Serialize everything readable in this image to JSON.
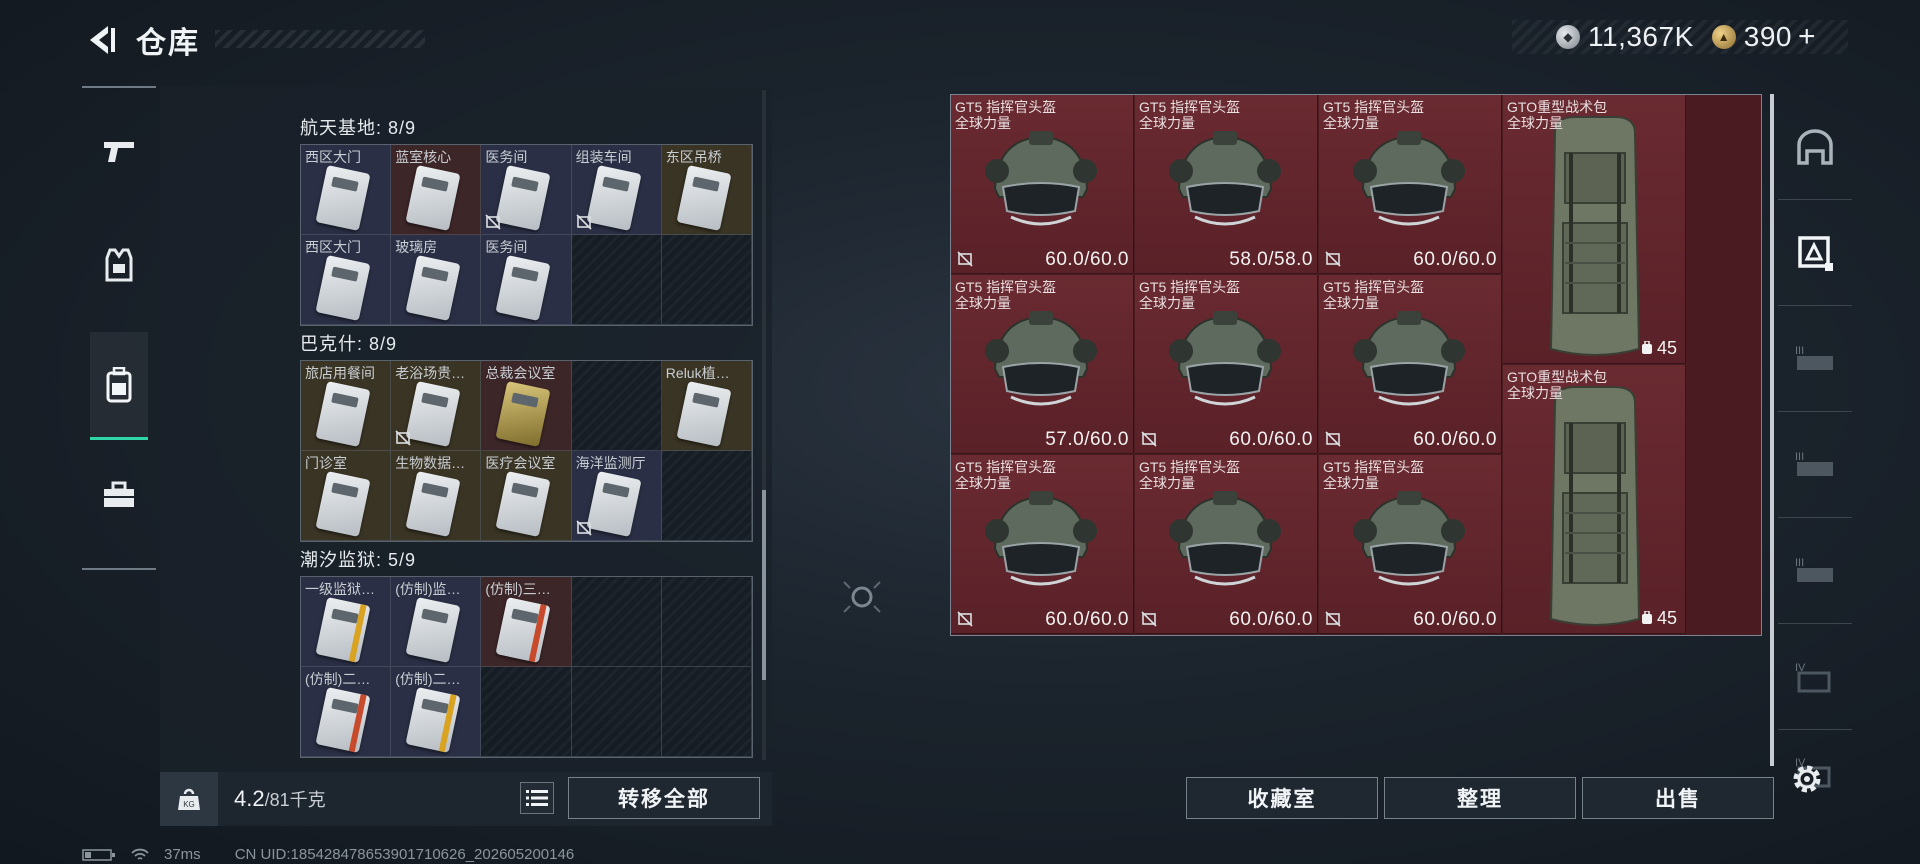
{
  "header": {
    "title": "仓库"
  },
  "currency": {
    "silver": "11,367K",
    "gold": "390",
    "plus": "+"
  },
  "left_rail": {
    "items": [
      "weapon",
      "armor",
      "backpack",
      "toolbox"
    ],
    "active_index": 2
  },
  "storage": {
    "sections": [
      {
        "title": "航天基地: 8/9",
        "cells": [
          {
            "name": "西区大门",
            "bg": "blue",
            "locked": false
          },
          {
            "name": "蓝室核心",
            "bg": "red",
            "locked": false
          },
          {
            "name": "医务间",
            "bg": "blue",
            "locked": true
          },
          {
            "name": "组装车间",
            "bg": "blue",
            "locked": true
          },
          {
            "name": "东区吊桥",
            "bg": "yellow",
            "locked": false
          },
          {
            "name": "西区大门",
            "bg": "blue",
            "locked": false
          },
          {
            "name": "玻璃房",
            "bg": "blue",
            "locked": false
          },
          {
            "name": "医务间",
            "bg": "blue",
            "locked": false
          },
          {
            "name": "",
            "bg": "empty",
            "locked": false
          },
          {
            "name": "",
            "bg": "empty",
            "locked": false
          }
        ]
      },
      {
        "title": "巴克什: 8/9",
        "cells": [
          {
            "name": "旅店用餐间",
            "bg": "yellow",
            "locked": false
          },
          {
            "name": "老浴场贵…",
            "bg": "yellow",
            "locked": true
          },
          {
            "name": "总裁会议室",
            "bg": "red",
            "locked": false,
            "gold": true
          },
          {
            "name": "",
            "bg": "empty",
            "locked": false
          },
          {
            "name": "Reluk植…",
            "bg": "yellow",
            "locked": false
          },
          {
            "name": "门诊室",
            "bg": "yellow",
            "locked": false
          },
          {
            "name": "生物数据…",
            "bg": "yellow",
            "locked": false
          },
          {
            "name": "医疗会议室",
            "bg": "yellow",
            "locked": false
          },
          {
            "name": "海洋监测厅",
            "bg": "blue",
            "locked": true
          },
          {
            "name": "",
            "bg": "empty",
            "locked": false
          }
        ]
      },
      {
        "title": "潮汐监狱: 5/9",
        "cells": [
          {
            "name": "一级监狱…",
            "bg": "blue",
            "locked": false,
            "stripe": "y"
          },
          {
            "name": "(仿制)监…",
            "bg": "blue",
            "locked": false
          },
          {
            "name": "(仿制)三…",
            "bg": "red",
            "locked": false,
            "stripe": "r"
          },
          {
            "name": "",
            "bg": "empty",
            "locked": false
          },
          {
            "name": "",
            "bg": "empty",
            "locked": false
          },
          {
            "name": "(仿制)二…",
            "bg": "blue",
            "locked": false,
            "stripe": "r"
          },
          {
            "name": "(仿制)二…",
            "bg": "blue",
            "locked": false,
            "stripe": "y"
          },
          {
            "name": "",
            "bg": "empty",
            "locked": false
          },
          {
            "name": "",
            "bg": "empty",
            "locked": false
          },
          {
            "name": "",
            "bg": "empty",
            "locked": false
          }
        ]
      }
    ]
  },
  "weight": {
    "current": "4.2",
    "max": "/81千克"
  },
  "buttons": {
    "transfer_all": "转移全部",
    "collection": "收藏室",
    "sort": "整理",
    "sell": "出售"
  },
  "items": [
    {
      "name1": "GT5 指挥官头盔",
      "name2": "全球力量",
      "value": "60.0/60.0",
      "type": "helmet",
      "locked": true,
      "col": 0,
      "row": 0
    },
    {
      "name1": "GT5 指挥官头盔",
      "name2": "全球力量",
      "value": "58.0/58.0",
      "type": "helmet",
      "locked": false,
      "col": 1,
      "row": 0
    },
    {
      "name1": "GT5 指挥官头盔",
      "name2": "全球力量",
      "value": "60.0/60.0",
      "type": "helmet",
      "locked": true,
      "col": 2,
      "row": 0
    },
    {
      "name1": "GT5 指挥官头盔",
      "name2": "全球力量",
      "value": "57.0/60.0",
      "type": "helmet",
      "locked": false,
      "col": 0,
      "row": 1
    },
    {
      "name1": "GT5 指挥官头盔",
      "name2": "全球力量",
      "value": "60.0/60.0",
      "type": "helmet",
      "locked": true,
      "col": 1,
      "row": 1
    },
    {
      "name1": "GT5 指挥官头盔",
      "name2": "全球力量",
      "value": "60.0/60.0",
      "type": "helmet",
      "locked": true,
      "col": 2,
      "row": 1
    },
    {
      "name1": "GT5 指挥官头盔",
      "name2": "全球力量",
      "value": "60.0/60.0",
      "type": "helmet",
      "locked": true,
      "col": 0,
      "row": 2
    },
    {
      "name1": "GT5 指挥官头盔",
      "name2": "全球力量",
      "value": "60.0/60.0",
      "type": "helmet",
      "locked": true,
      "col": 1,
      "row": 2
    },
    {
      "name1": "GT5 指挥官头盔",
      "name2": "全球力量",
      "value": "60.0/60.0",
      "type": "helmet",
      "locked": true,
      "col": 2,
      "row": 2
    },
    {
      "name1": "GTO重型战术包",
      "name2": "全球力量",
      "value": "45",
      "type": "backpack",
      "locked": false,
      "col": 3,
      "row": 0
    },
    {
      "name1": "GTO重型战术包",
      "name2": "全球力量",
      "value": "45",
      "type": "backpack",
      "locked": false,
      "col": 3,
      "row": 1.5
    }
  ],
  "right_tabs": [
    "base-icon",
    "box-icon",
    "III",
    "III",
    "III",
    "IV",
    "IV"
  ],
  "status": {
    "ping": "37ms",
    "uid": "CN UID:185428478653901710626_202605200146"
  }
}
